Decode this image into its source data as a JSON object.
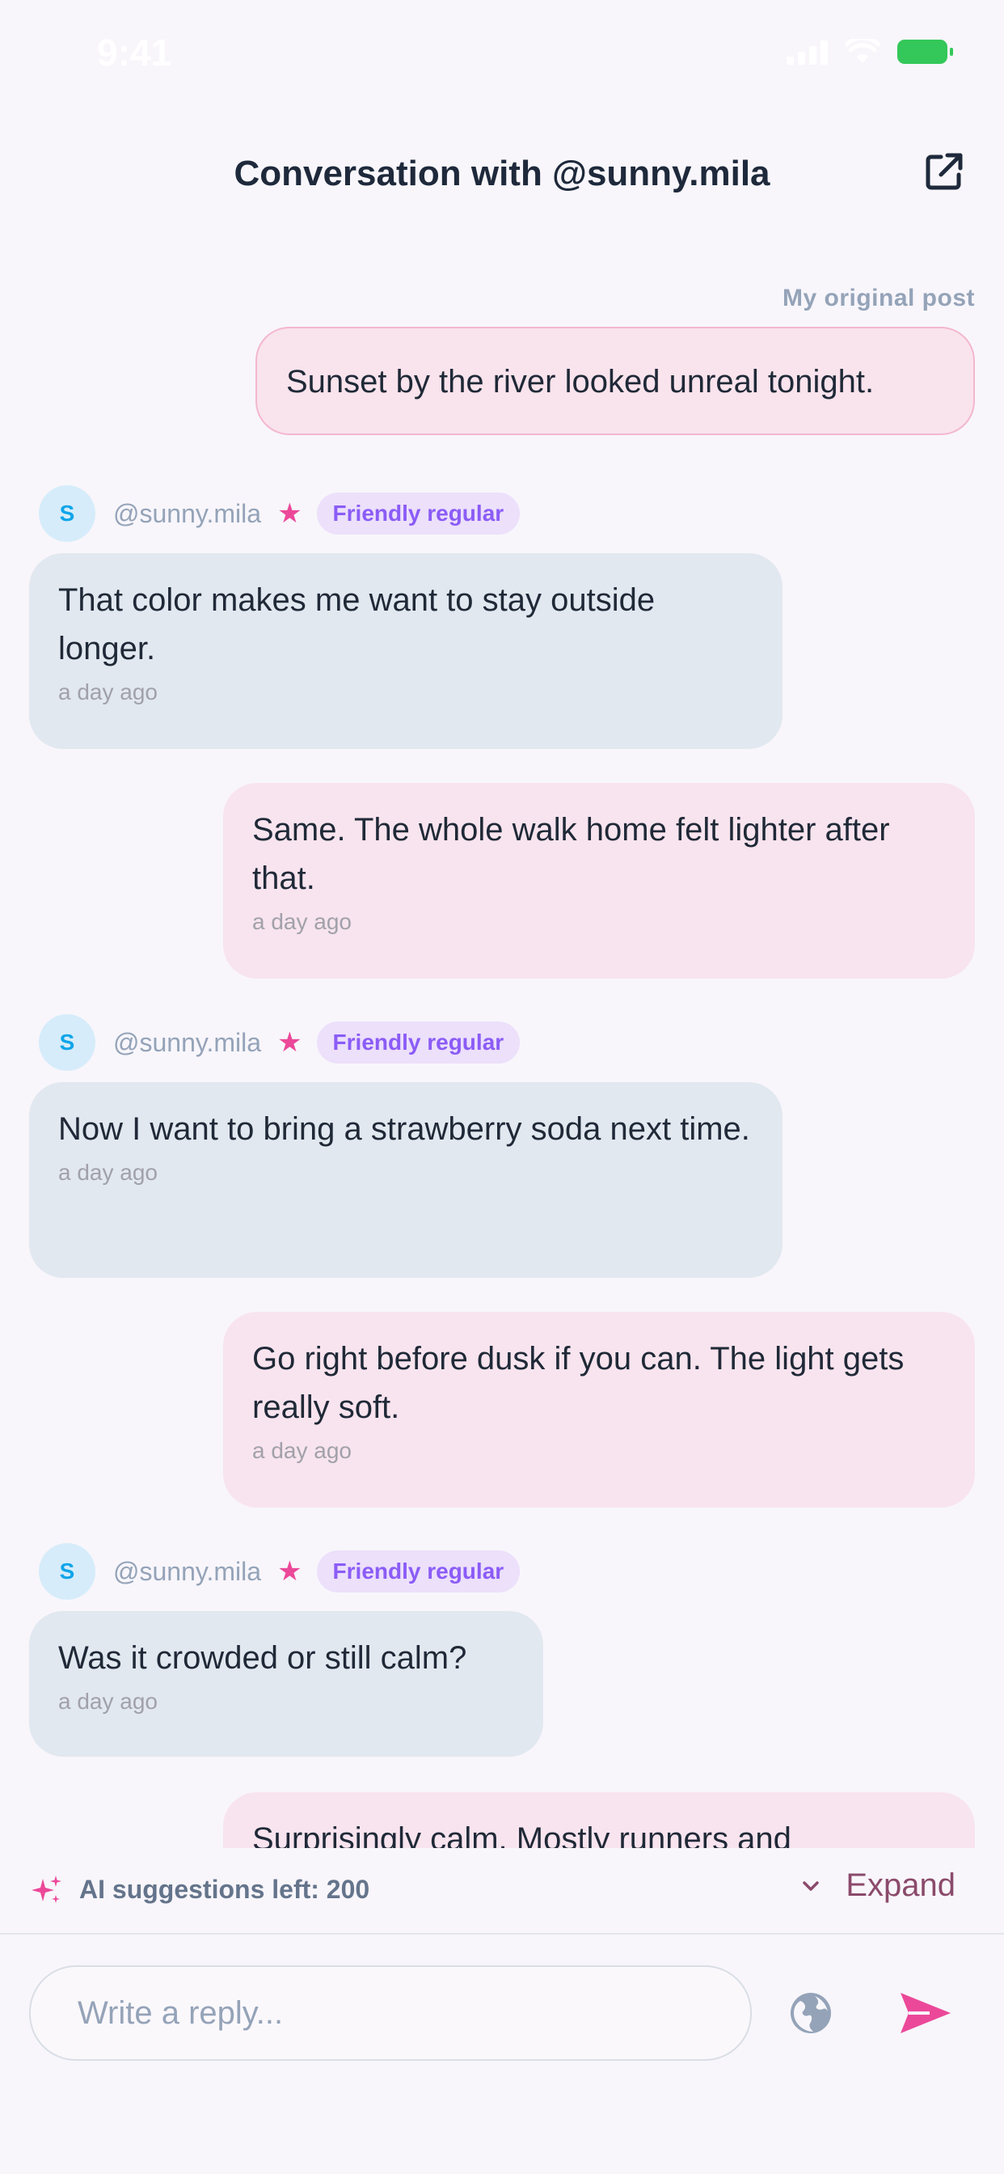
{
  "status": {
    "time": "9:41"
  },
  "header": {
    "title": "Conversation with @sunny.mila"
  },
  "original_post": {
    "label": "My original post",
    "text": "Sunset by the river looked unreal tonight."
  },
  "contact": {
    "initial": "S",
    "handle": "@sunny.mila",
    "star": "★",
    "badge": "Friendly regular"
  },
  "messages": [
    {
      "from": "them",
      "text": "That color makes me want to stay outside longer.",
      "time": "a day ago"
    },
    {
      "from": "me",
      "text": "Same. The whole walk home felt lighter after that.",
      "time": "a day ago"
    },
    {
      "from": "them",
      "text": "Now I want to bring a strawberry soda next time.",
      "time": "a day ago"
    },
    {
      "from": "me",
      "text": "Go right before dusk if you can. The light gets really soft.",
      "time": "a day ago"
    },
    {
      "from": "them",
      "text": "Was it crowded or still calm?",
      "time": "a day ago"
    },
    {
      "from": "me",
      "text": "Surprisingly calm. Mostly runners and",
      "time": ""
    }
  ],
  "ai_bar": {
    "text": "AI suggestions left: 200",
    "expand_label": "Expand"
  },
  "composer": {
    "placeholder": "Write a reply..."
  },
  "colors": {
    "accent_pink": "#ec4899",
    "my_bubble": "#f8e4ee",
    "their_bubble": "#e2e8f0",
    "badge_purple": "#8b5cf6"
  }
}
